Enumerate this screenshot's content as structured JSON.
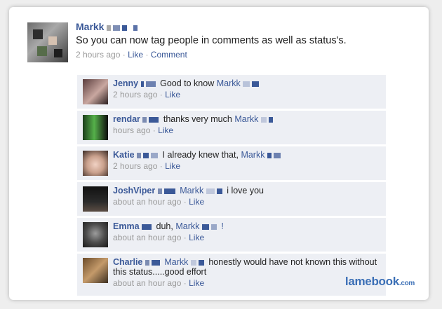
{
  "post": {
    "author": "Markk",
    "text": "So you can now tag people in comments as well as status's.",
    "time": "2 hours ago",
    "like_label": "Like",
    "comment_label": "Comment",
    "separator": "·"
  },
  "comments": [
    {
      "name": "Jenny",
      "text": "Good to know",
      "tag": "Markk",
      "text_after": "",
      "time": "2 hours ago",
      "like_label": "Like"
    },
    {
      "name": "rendar",
      "text": "thanks very much",
      "tag": "Markk",
      "text_after": "",
      "time": "hours ago",
      "like_label": "Like"
    },
    {
      "name": "Katie",
      "text": "I already knew that,",
      "tag": "Markk",
      "text_after": "",
      "time": "2 hours ago",
      "like_label": "Like"
    },
    {
      "name": "JoshViper",
      "text": "",
      "tag": "Markk",
      "text_after": "i love you",
      "time": "about an hour ago",
      "like_label": "Like"
    },
    {
      "name": "Emma",
      "text": "duh,",
      "tag": "Markk",
      "text_after": "!",
      "time": "about an hour ago",
      "like_label": "Like"
    },
    {
      "name": "Charlie",
      "text": "",
      "tag": "Markk",
      "text_after": "honestly would have not known this without this status.....good effort",
      "time": "about an hour ago",
      "like_label": "Like"
    }
  ],
  "watermark": {
    "brand": "lamebook",
    "suffix": ".com"
  },
  "colors": {
    "link": "#3b5998",
    "comment_bg": "#edeff4",
    "meta": "#999999"
  }
}
